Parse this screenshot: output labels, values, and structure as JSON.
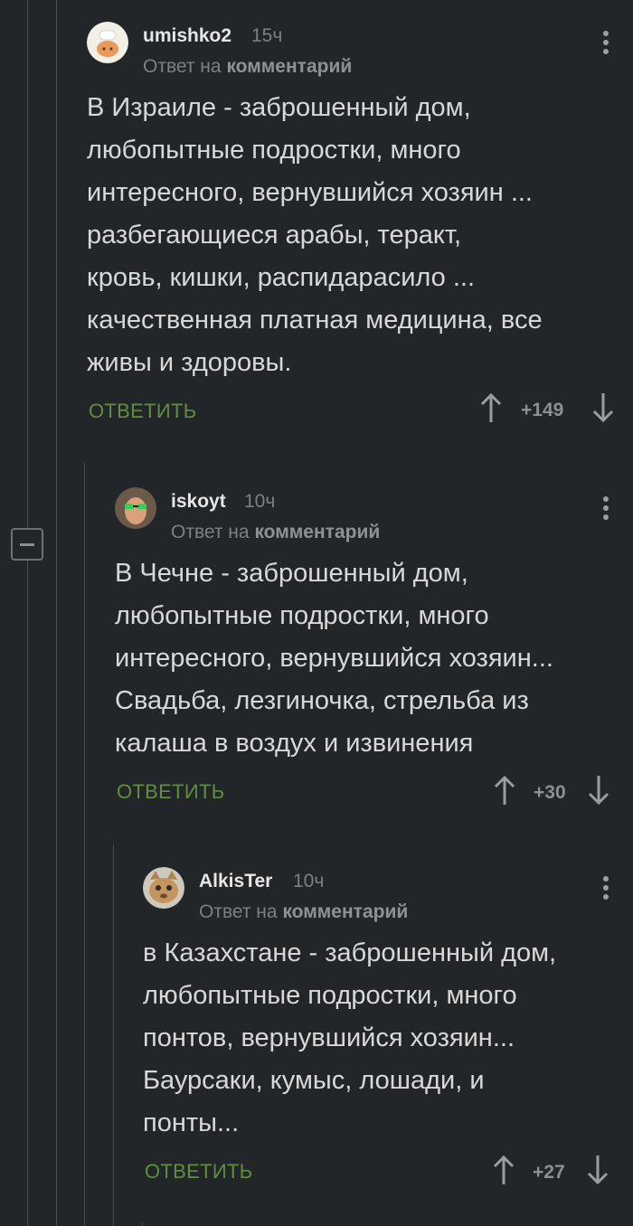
{
  "comments": [
    {
      "author": "umishko2",
      "time": "15ч",
      "reply_prefix": "Ответ на",
      "reply_target": "комментарий",
      "text": "В Израиле - заброшенный дом,\nлюбопытные подростки, много\nинтересного, вернувшийся хозяин ...\nразбегающиеся арабы, теракт,\nкровь, кишки, распидарасило ...\nкачественная платная медицина, все\nживы и здоровы.",
      "reply_label": "ОТВЕТИТЬ",
      "rating": "+149",
      "avatar_icon": "chef-avatar-icon"
    },
    {
      "author": "iskoyt",
      "time": "10ч",
      "reply_prefix": "Ответ на",
      "reply_target": "комментарий",
      "text": "В Чечне - заброшенный дом,\nлюбопытные подростки, много\nинтересного, вернувшийся хозяин...\nСвадьба, лезгиночка, стрельба из\nкалаша в воздух и извинения",
      "reply_label": "ОТВЕТИТЬ",
      "rating": "+30",
      "avatar_icon": "man-sunglasses-avatar-icon"
    },
    {
      "author": "AlkisTer",
      "time": "10ч",
      "reply_prefix": "Ответ на",
      "reply_target": "комментарий",
      "text": "в Казахстане - заброшенный дом,\nлюбопытные подростки, много\nпонтов, вернувшийся хозяин...\nБаурсаки, кумыс, лошади, и\nпонты...",
      "reply_label": "ОТВЕТИТЬ",
      "rating": "+27",
      "avatar_icon": "cat-avatar-icon"
    }
  ],
  "colors": {
    "background": "#232629",
    "reply_green": "#5f8f3e",
    "thread_line": "#4a4e52"
  }
}
